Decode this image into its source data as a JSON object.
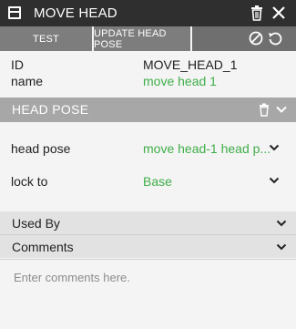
{
  "window": {
    "title": "MOVE HEAD",
    "icons": [
      "window-icon",
      "trash-icon",
      "close-icon"
    ]
  },
  "toolbar": {
    "test_label": "TEST",
    "update_label": "UPDATE HEAD POSE",
    "icons": [
      "disable-icon",
      "undo-icon"
    ]
  },
  "properties": {
    "id_label": "ID",
    "id_value": "MOVE_HEAD_1",
    "name_label": "name",
    "name_value": "move head 1"
  },
  "head_pose_section": {
    "title": "HEAD POSE",
    "icons": [
      "trash-icon",
      "chevron-down-icon"
    ],
    "fields": [
      {
        "label": "head pose",
        "value": "move head-1 head p..."
      },
      {
        "label": "lock to",
        "value": "Base"
      }
    ]
  },
  "used_by": {
    "title": "Used By"
  },
  "comments": {
    "title": "Comments",
    "placeholder": "Enter comments here."
  },
  "colors": {
    "titlebar": "#2f2f2f",
    "toolbar": "#6f6f6f",
    "section_header": "#a7a7a7",
    "link_green": "#3fae49"
  }
}
